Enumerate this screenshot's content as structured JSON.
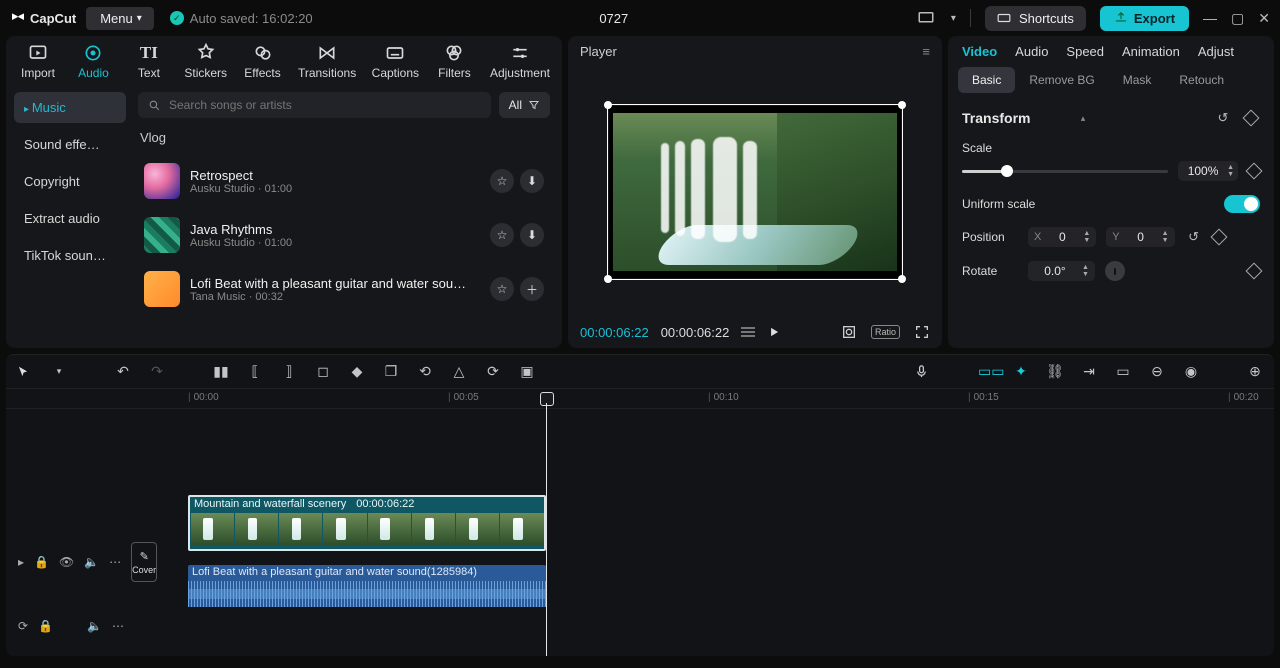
{
  "titlebar": {
    "app": "CapCut",
    "menu": "Menu",
    "autosave": "Auto saved: 16:02:20",
    "project": "0727",
    "shortcuts": "Shortcuts",
    "export": "Export"
  },
  "top_tabs": {
    "import": "Import",
    "audio": "Audio",
    "text": "Text",
    "stickers": "Stickers",
    "effects": "Effects",
    "transitions": "Transitions",
    "captions": "Captions",
    "filters": "Filters",
    "adjustment": "Adjustment",
    "active": "audio"
  },
  "audio": {
    "cats": {
      "music": "Music",
      "se": "Sound effe…",
      "copyright": "Copyright",
      "extract": "Extract audio",
      "tiktok": "TikTok soun…"
    },
    "search_placeholder": "Search songs or artists",
    "filter_all": "All",
    "section": "Vlog",
    "tracks": [
      {
        "title": "Retrospect",
        "sub": "Ausku Studio · 01:00",
        "fav": true,
        "dl": true
      },
      {
        "title": "Java Rhythms",
        "sub": "Ausku Studio · 01:00",
        "fav": true,
        "dl": true
      },
      {
        "title": "Lofi Beat with a pleasant guitar and water sou…",
        "sub": "Tana Music · 00:32",
        "fav": true,
        "add": true
      }
    ]
  },
  "player": {
    "label": "Player",
    "cur": "00:00:06:22",
    "dur": "00:00:06:22",
    "ratio": "Ratio"
  },
  "right": {
    "tabs": {
      "video": "Video",
      "audio": "Audio",
      "speed": "Speed",
      "animation": "Animation",
      "adjust": "Adjust"
    },
    "subtabs": {
      "basic": "Basic",
      "removebg": "Remove BG",
      "mask": "Mask",
      "retouch": "Retouch"
    },
    "transform": "Transform",
    "scale_label": "Scale",
    "scale_value": "100%",
    "uniform": "Uniform scale",
    "position": "Position",
    "pos_x_label": "X",
    "pos_x_val": "0",
    "pos_y_label": "Y",
    "pos_y_val": "0",
    "rotate": "Rotate",
    "rotate_val": "0.0°"
  },
  "timeline": {
    "ticks": [
      "00:00",
      "00:05",
      "00:10",
      "00:15",
      "00:20"
    ],
    "cover": "Cover",
    "vclip_name": "Mountain and waterfall scenery",
    "vclip_time": "00:00:06:22",
    "aclip_name": "Lofi Beat with a pleasant guitar and water sound(1285984)"
  }
}
